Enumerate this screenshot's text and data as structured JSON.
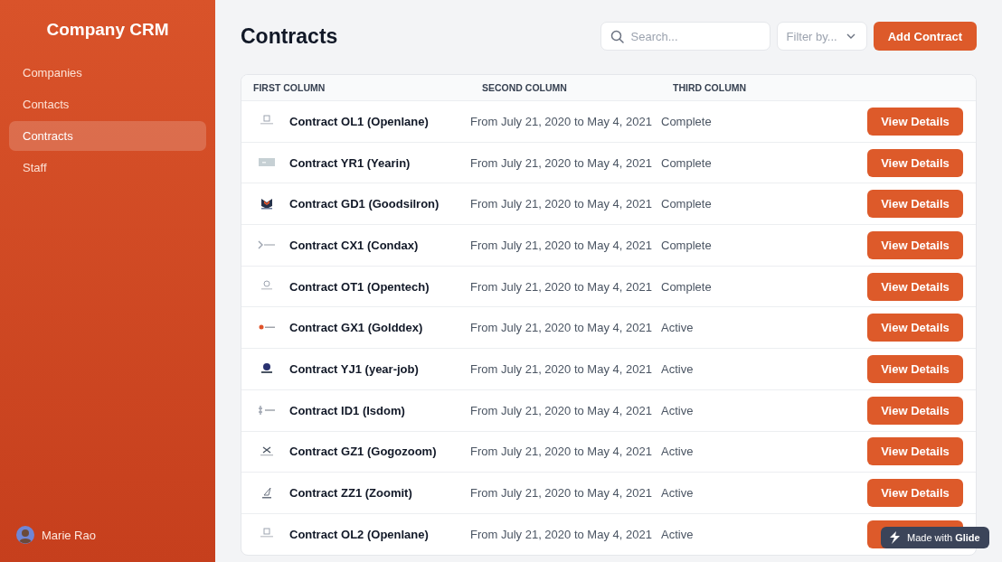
{
  "sidebar": {
    "title": "Company CRM",
    "items": [
      {
        "label": "Companies",
        "selected": false
      },
      {
        "label": "Contacts",
        "selected": false
      },
      {
        "label": "Contracts",
        "selected": true
      },
      {
        "label": "Staff",
        "selected": false
      }
    ],
    "user": {
      "name": "Marie Rao"
    }
  },
  "header": {
    "title": "Contracts",
    "search": {
      "placeholder": "Search..."
    },
    "filter": {
      "placeholder": "Filter by..."
    },
    "add_button": "Add Contract"
  },
  "table": {
    "columns": [
      "FIRST COLUMN",
      "SECOND COLUMN",
      "THIRD COLUMN"
    ],
    "rows": [
      {
        "name": "Contract OL1 (Openlane)",
        "period": "From July 21, 2020 to May 4, 2021",
        "status": "Complete",
        "action": "View Details"
      },
      {
        "name": "Contract YR1 (Yearin)",
        "period": "From July 21, 2020 to May 4, 2021",
        "status": "Complete",
        "action": "View Details"
      },
      {
        "name": "Contract GD1 (Goodsilron)",
        "period": "From July 21, 2020 to May 4, 2021",
        "status": "Complete",
        "action": "View Details"
      },
      {
        "name": "Contract CX1 (Condax)",
        "period": "From July 21, 2020 to May 4, 2021",
        "status": "Complete",
        "action": "View Details"
      },
      {
        "name": "Contract OT1 (Opentech)",
        "period": "From July 21, 2020 to May 4, 2021",
        "status": "Complete",
        "action": "View Details"
      },
      {
        "name": "Contract GX1 (Golddex)",
        "period": "From July 21, 2020 to May 4, 2021",
        "status": "Active",
        "action": "View Details"
      },
      {
        "name": "Contract YJ1 (year-job)",
        "period": "From July 21, 2020 to May 4, 2021",
        "status": "Active",
        "action": "View Details"
      },
      {
        "name": "Contract ID1 (Isdom)",
        "period": "From July 21, 2020 to May 4, 2021",
        "status": "Active",
        "action": "View Details"
      },
      {
        "name": "Contract GZ1 (Gogozoom)",
        "period": "From July 21, 2020 to May 4, 2021",
        "status": "Active",
        "action": "View Details"
      },
      {
        "name": "Contract ZZ1 (Zoomit)",
        "period": "From July 21, 2020 to May 4, 2021",
        "status": "Active",
        "action": "View Details"
      },
      {
        "name": "Contract OL2 (Openlane)",
        "period": "From July 21, 2020 to May 4, 2021",
        "status": "Active"
      }
    ]
  },
  "badge": "Made with **Glide**"
}
